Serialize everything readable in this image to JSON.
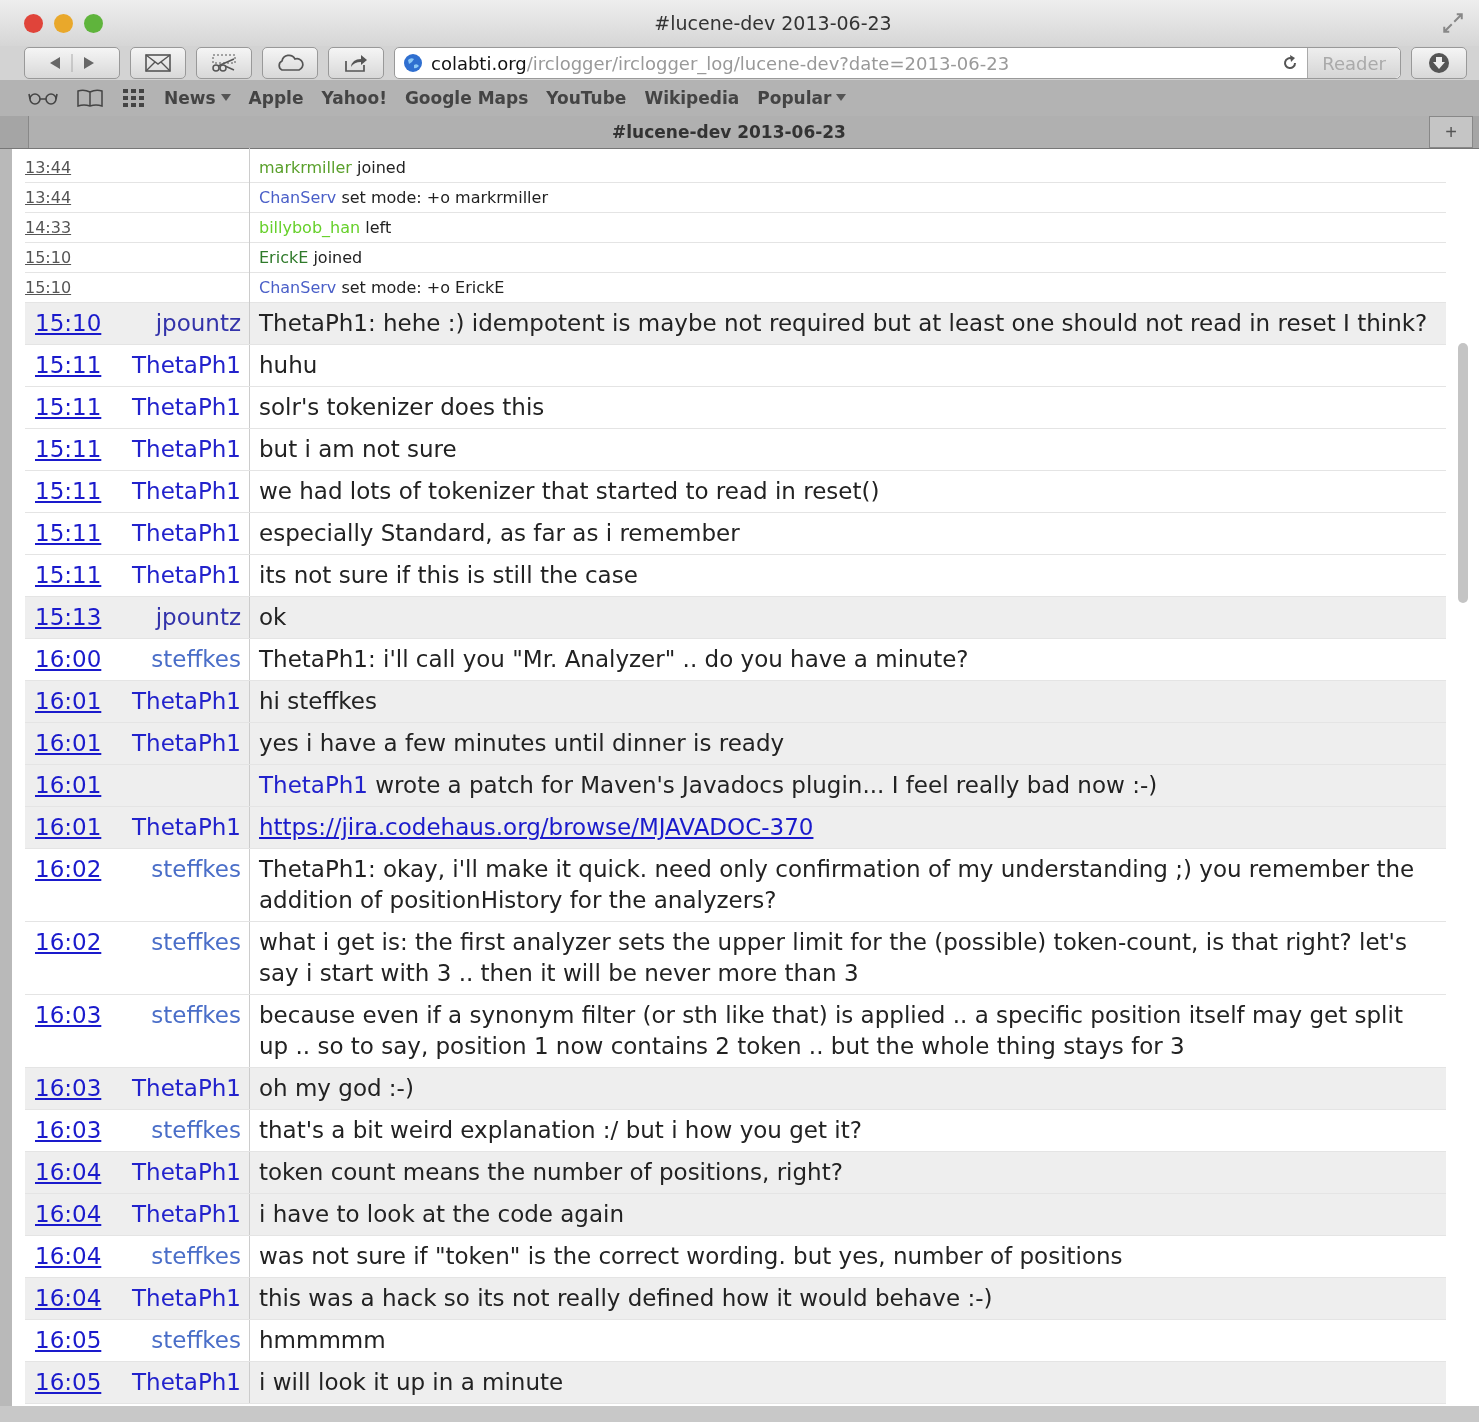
{
  "window": {
    "title": "#lucene-dev 2013-06-23"
  },
  "address": {
    "host": "colabti.org",
    "path": "/irclogger/irclogger_log/lucene-dev?date=2013-06-23"
  },
  "reader_button": "Reader",
  "bookmarks": [
    {
      "label": "News",
      "menu": true
    },
    {
      "label": "Apple",
      "menu": false
    },
    {
      "label": "Yahoo!",
      "menu": false
    },
    {
      "label": "Google Maps",
      "menu": false
    },
    {
      "label": "YouTube",
      "menu": false
    },
    {
      "label": "Wikipedia",
      "menu": false
    },
    {
      "label": "Popular",
      "menu": true
    }
  ],
  "tab": {
    "title": "#lucene-dev 2013-06-23",
    "add": "+"
  },
  "log": [
    {
      "kind": "event",
      "time": "13:44",
      "nick": "markrmiller",
      "color": "#5aa02c",
      "text": "joined"
    },
    {
      "kind": "event",
      "time": "13:44",
      "nick": "ChanServ",
      "color": "#4a5fc8",
      "text": "set mode: +o markrmiller"
    },
    {
      "kind": "event",
      "time": "14:33",
      "nick": "billybob_han",
      "color": "#66d02a",
      "text": "left"
    },
    {
      "kind": "event",
      "time": "15:10",
      "nick": "ErickE",
      "color": "#2f7a2a",
      "text": "joined"
    },
    {
      "kind": "event",
      "time": "15:10",
      "nick": "ChanServ",
      "color": "#4a5fc8",
      "text": "set mode: +o ErickE"
    },
    {
      "kind": "message",
      "time": "15:10",
      "nick": "jpountz",
      "color": "#3333aa",
      "shaded": true,
      "text": "ThetaPh1: hehe :) idempotent is maybe not required but at least one should not read in reset I think?"
    },
    {
      "kind": "message",
      "time": "15:11",
      "nick": "ThetaPh1",
      "color": "#2222cc",
      "shaded": false,
      "text": "huhu"
    },
    {
      "kind": "message",
      "time": "15:11",
      "nick": "ThetaPh1",
      "color": "#2222cc",
      "shaded": false,
      "text": "solr's tokenizer does this"
    },
    {
      "kind": "message",
      "time": "15:11",
      "nick": "ThetaPh1",
      "color": "#2222cc",
      "shaded": false,
      "text": "but i am not sure"
    },
    {
      "kind": "message",
      "time": "15:11",
      "nick": "ThetaPh1",
      "color": "#2222cc",
      "shaded": false,
      "text": "we had lots of tokenizer that started to read in reset()"
    },
    {
      "kind": "message",
      "time": "15:11",
      "nick": "ThetaPh1",
      "color": "#2222cc",
      "shaded": false,
      "text": "especially Standard, as far as i remember"
    },
    {
      "kind": "message",
      "time": "15:11",
      "nick": "ThetaPh1",
      "color": "#2222cc",
      "shaded": false,
      "text": "its not sure if this is still the case"
    },
    {
      "kind": "message",
      "time": "15:13",
      "nick": "jpountz",
      "color": "#3333aa",
      "shaded": true,
      "text": "ok"
    },
    {
      "kind": "message",
      "time": "16:00",
      "nick": "steffkes",
      "color": "#4a6ec8",
      "shaded": false,
      "text": "ThetaPh1: i'll call you \"Mr. Analyzer\" .. do you have a minute?"
    },
    {
      "kind": "message",
      "time": "16:01",
      "nick": "ThetaPh1",
      "color": "#2222cc",
      "shaded": true,
      "text": "hi steffkes"
    },
    {
      "kind": "message",
      "time": "16:01",
      "nick": "ThetaPh1",
      "color": "#2222cc",
      "shaded": true,
      "text": "yes i have a few minutes until dinner is ready"
    },
    {
      "kind": "action",
      "time": "16:01",
      "nick": "ThetaPh1",
      "color": "#2222cc",
      "shaded": true,
      "text": "wrote a patch for Maven's Javadocs plugin... I feel really bad now :-)"
    },
    {
      "kind": "link",
      "time": "16:01",
      "nick": "ThetaPh1",
      "color": "#2222cc",
      "shaded": true,
      "text": "https://jira.codehaus.org/browse/MJAVADOC-370"
    },
    {
      "kind": "message",
      "time": "16:02",
      "nick": "steffkes",
      "color": "#4a6ec8",
      "shaded": false,
      "text": "ThetaPh1: okay, i'll make it quick. need only confirmation of my understanding ;) you remember the addition of positionHistory for the analyzers?"
    },
    {
      "kind": "message",
      "time": "16:02",
      "nick": "steffkes",
      "color": "#4a6ec8",
      "shaded": false,
      "text": "what i get is: the first analyzer sets the upper limit for the (possible) token-count, is that right? let's say i start with 3 .. then it will be never more than 3"
    },
    {
      "kind": "message",
      "time": "16:03",
      "nick": "steffkes",
      "color": "#4a6ec8",
      "shaded": false,
      "text": "because even if a synonym filter (or sth like that) is applied .. a specific position itself may get split up .. so to say, position 1 now contains 2 token .. but the whole thing stays for 3"
    },
    {
      "kind": "message",
      "time": "16:03",
      "nick": "ThetaPh1",
      "color": "#2222cc",
      "shaded": true,
      "text": "oh my god :-)"
    },
    {
      "kind": "message",
      "time": "16:03",
      "nick": "steffkes",
      "color": "#4a6ec8",
      "shaded": false,
      "text": "that's a bit weird explanation :/ but i how you get it?"
    },
    {
      "kind": "message",
      "time": "16:04",
      "nick": "ThetaPh1",
      "color": "#2222cc",
      "shaded": true,
      "text": "token count means the number of positions, right?"
    },
    {
      "kind": "message",
      "time": "16:04",
      "nick": "ThetaPh1",
      "color": "#2222cc",
      "shaded": true,
      "text": "i have to look at the code again"
    },
    {
      "kind": "message",
      "time": "16:04",
      "nick": "steffkes",
      "color": "#4a6ec8",
      "shaded": false,
      "text": "was not sure if \"token\" is the correct wording. but yes, number of positions"
    },
    {
      "kind": "message",
      "time": "16:04",
      "nick": "ThetaPh1",
      "color": "#2222cc",
      "shaded": true,
      "text": "this was a hack so its not really defined how it would behave :-)"
    },
    {
      "kind": "message",
      "time": "16:05",
      "nick": "steffkes",
      "color": "#4a6ec8",
      "shaded": false,
      "text": "hmmmmm"
    },
    {
      "kind": "message",
      "time": "16:05",
      "nick": "ThetaPh1",
      "color": "#2222cc",
      "shaded": true,
      "text": "i will look it up in a minute"
    }
  ]
}
